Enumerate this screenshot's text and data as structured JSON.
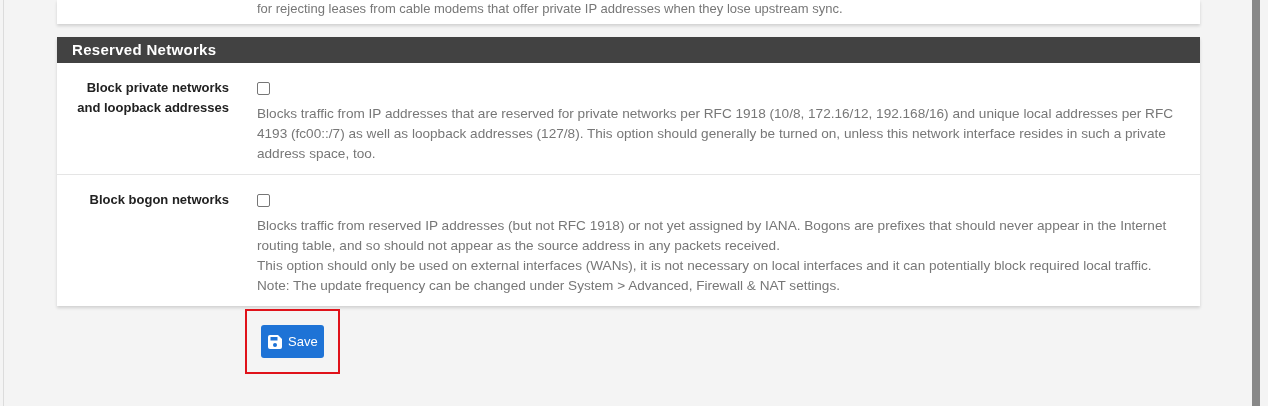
{
  "previous_panel": {
    "help_tail": "for rejecting leases from cable modems that offer private IP addresses when they lose upstream sync."
  },
  "section": {
    "title": "Reserved Networks",
    "rows": [
      {
        "label": "Block private networks and loopback addresses",
        "checked": false,
        "help": [
          "Blocks traffic from IP addresses that are reserved for private networks per RFC 1918 (10/8, 172.16/12, 192.168/16) and unique local addresses per RFC 4193 (fc00::/7) as well as loopback addresses (127/8). This option should generally be turned on, unless this network interface resides in such a private address space, too."
        ]
      },
      {
        "label": "Block bogon networks",
        "checked": false,
        "help": [
          "Blocks traffic from reserved IP addresses (but not RFC 1918) or not yet assigned by IANA. Bogons are prefixes that should never appear in the Internet routing table, and so should not appear as the source address in any packets received.",
          "This option should only be used on external interfaces (WANs), it is not necessary on local interfaces and it can potentially block required local traffic.",
          "Note: The update frequency can be changed under System > Advanced, Firewall & NAT settings."
        ]
      }
    ]
  },
  "save_button": {
    "label": "Save",
    "highlighted": true
  }
}
